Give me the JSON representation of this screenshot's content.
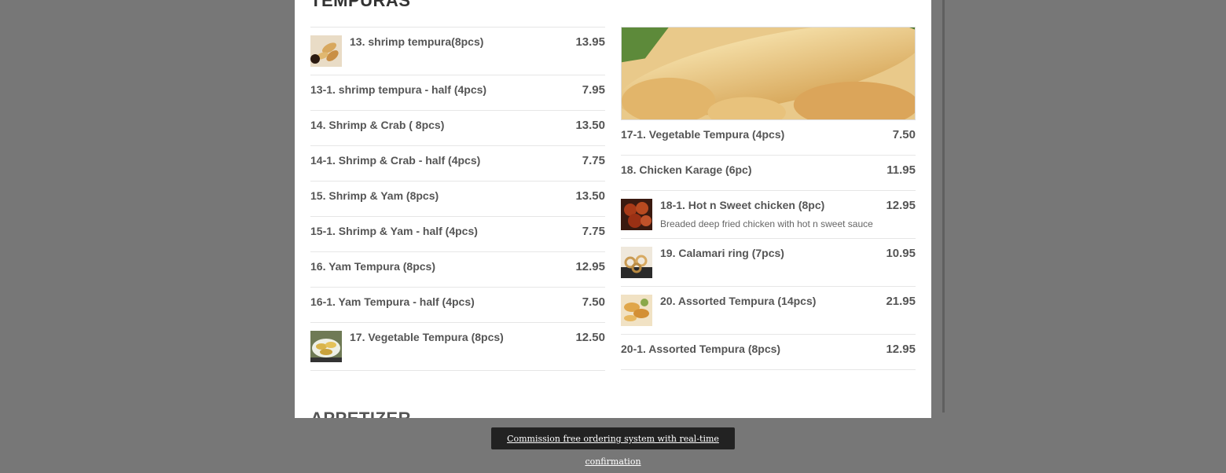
{
  "section": {
    "title": "TEMPURAS",
    "next_title": "APPETIZER"
  },
  "left_items": [
    {
      "name": "13. shrimp tempura(8pcs)",
      "price": "13.95",
      "thumb": "shrimp-tempura-thumb"
    },
    {
      "name": "13-1. shrimp tempura - half (4pcs)",
      "price": "7.95"
    },
    {
      "name": "14. Shrimp & Crab ( 8pcs)",
      "price": "13.50"
    },
    {
      "name": "14-1. Shrimp & Crab - half (4pcs)",
      "price": "7.75"
    },
    {
      "name": "15. Shrimp & Yam (8pcs)",
      "price": "13.50"
    },
    {
      "name": "15-1. Shrimp & Yam - half (4pcs)",
      "price": "7.75"
    },
    {
      "name": "16. Yam Tempura (8pcs)",
      "price": "12.95"
    },
    {
      "name": "16-1. Yam Tempura - half (4pcs)",
      "price": "7.50"
    },
    {
      "name": "17. Vegetable Tempura (8pcs)",
      "price": "12.50",
      "thumb": "vegetable-tempura-thumb"
    }
  ],
  "right_items": [
    {
      "name": "17-1. Vegetable Tempura (4pcs)",
      "price": "7.50"
    },
    {
      "name": "18. Chicken Karage (6pc)",
      "price": "11.95"
    },
    {
      "name": "18-1. Hot n Sweet chicken (8pc)",
      "price": "12.95",
      "desc": "Breaded deep fried chicken with hot n sweet sauce",
      "thumb": "hot-sweet-chicken-thumb"
    },
    {
      "name": "19. Calamari ring (7pcs)",
      "price": "10.95",
      "thumb": "calamari-thumb"
    },
    {
      "name": "20. Assorted Tempura (14pcs)",
      "price": "21.95",
      "thumb": "assorted-tempura-thumb"
    },
    {
      "name": "20-1. Assorted Tempura (8pcs)",
      "price": "12.95"
    }
  ],
  "banner": {
    "link_text": "Commission free ordering system with real-time confirmation"
  }
}
